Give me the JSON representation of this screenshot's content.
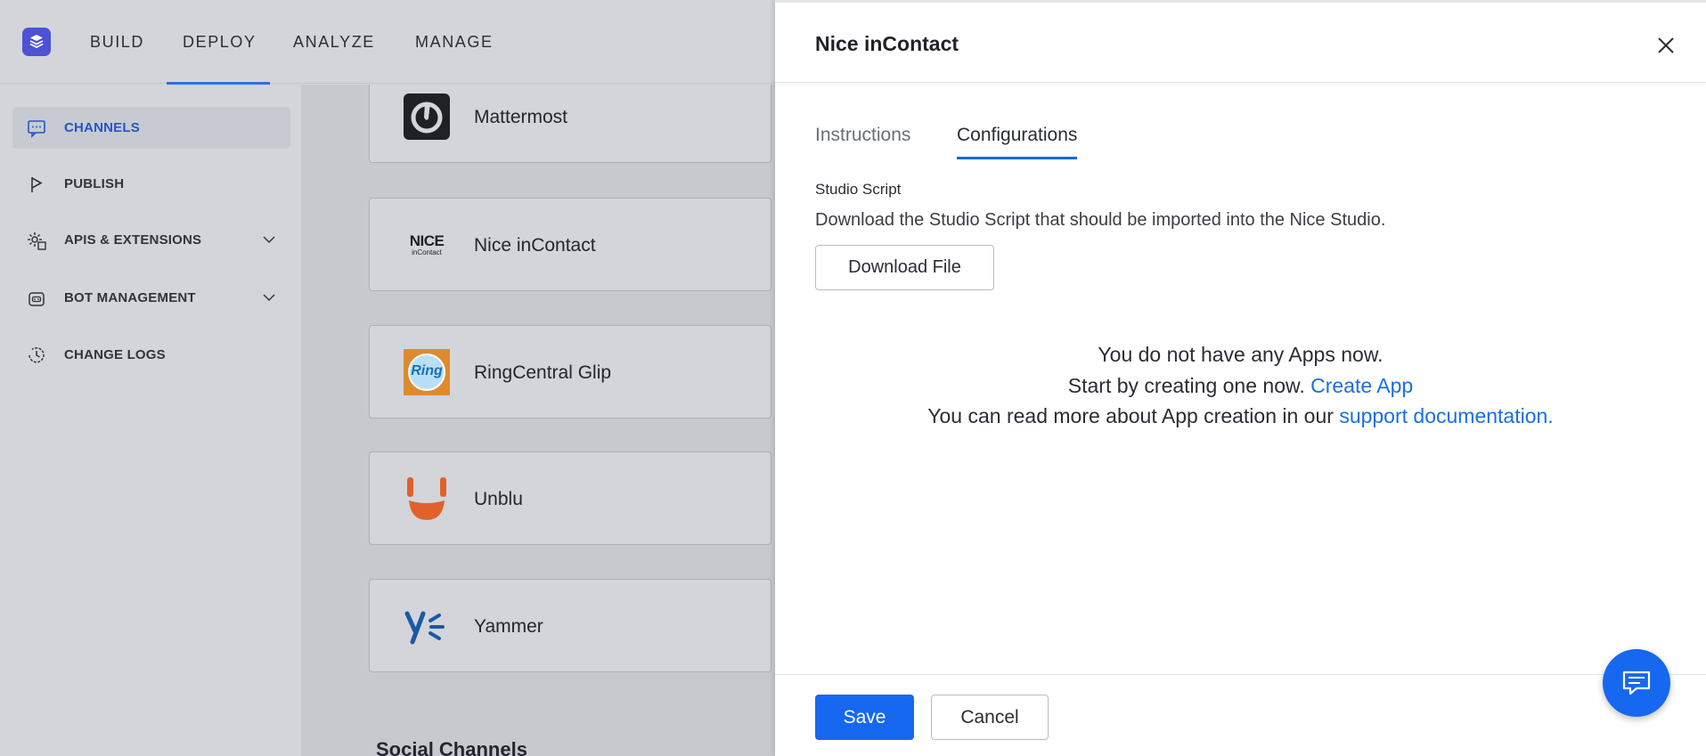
{
  "nav": {
    "items": [
      {
        "label": "BUILD"
      },
      {
        "label": "DEPLOY"
      },
      {
        "label": "ANALYZE"
      },
      {
        "label": "MANAGE"
      }
    ],
    "active": "DEPLOY"
  },
  "sidebar": {
    "items": [
      {
        "label": "CHANNELS",
        "icon": "chat-bubble-icon",
        "active": true
      },
      {
        "label": "PUBLISH",
        "icon": "flag-icon"
      },
      {
        "label": "APIS & EXTENSIONS",
        "icon": "gear-extension-icon",
        "expandable": true
      },
      {
        "label": "BOT MANAGEMENT",
        "icon": "bot-icon",
        "expandable": true
      },
      {
        "label": "CHANGE LOGS",
        "icon": "history-clock-icon"
      }
    ]
  },
  "channels": {
    "items": [
      {
        "name": "Mattermost",
        "logo": "mattermost-logo"
      },
      {
        "name": "Nice inContact",
        "logo": "nice-incontact-logo",
        "logo_text": "NICE",
        "logo_subtext": "inContact"
      },
      {
        "name": "RingCentral Glip",
        "logo": "ringcentral-logo",
        "logo_text": "Ring"
      },
      {
        "name": "Unblu",
        "logo": "unblu-logo"
      },
      {
        "name": "Yammer",
        "logo": "yammer-logo"
      }
    ],
    "section_title": "Social Channels"
  },
  "panel": {
    "title": "Nice inContact",
    "tabs": [
      {
        "label": "Instructions"
      },
      {
        "label": "Configurations"
      }
    ],
    "active_tab": "Configurations",
    "studio_script": {
      "label": "Studio Script",
      "description": "Download the Studio Script that should be imported into the Nice Studio.",
      "button": "Download File"
    },
    "empty_state": {
      "line1": "You do not have any Apps now.",
      "line2_prefix": "Start by creating one now.",
      "line2_link": "Create App",
      "line3_prefix": "You can read more about App creation in our",
      "line3_link": "support documentation."
    },
    "footer": {
      "save": "Save",
      "cancel": "Cancel"
    }
  },
  "colors": {
    "accent": "#1668f0",
    "link": "#1a6fe0",
    "logo_bg": "#4d52d6"
  }
}
